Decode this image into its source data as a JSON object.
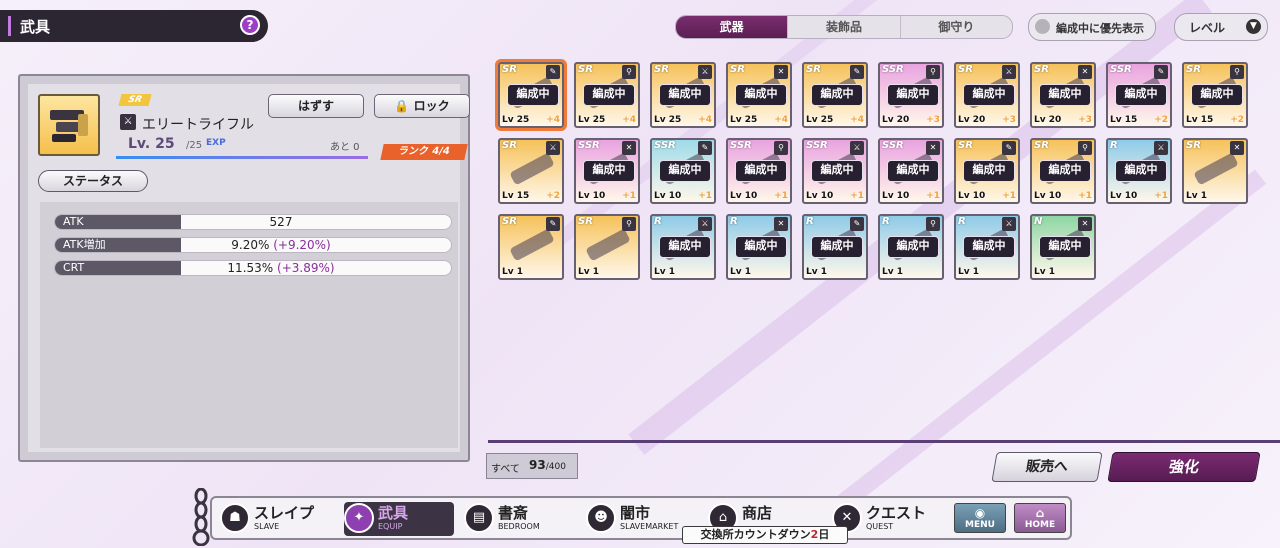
{
  "header": {
    "title": "武具",
    "help_label": "?"
  },
  "tabs": [
    {
      "label": "武器",
      "active": true
    },
    {
      "label": "装飾品"
    },
    {
      "label": "御守り"
    }
  ],
  "priority_toggle": {
    "label": "編成中に優先表示"
  },
  "sort": {
    "label": "レベル",
    "caret": "▼"
  },
  "detail": {
    "rarity": "SR",
    "weapon_name": "エリートライフル",
    "unequip_label": "はずす",
    "lock_label": "ロック",
    "level": "Lv. 25",
    "level_max": "/25",
    "exp_label": "EXP",
    "remaining": "あと 0",
    "rank": "ランク 4/4",
    "status_label": "ステータス",
    "stats": [
      {
        "label": "ATK",
        "value": "527",
        "bonus": ""
      },
      {
        "label": "ATK増加",
        "value": "9.20%",
        "bonus": "(+9.20%)"
      },
      {
        "label": "CRT",
        "value": "11.53%",
        "bonus": "(+3.89%)"
      }
    ]
  },
  "equipped_label": "編成中",
  "items": [
    {
      "rarity": "SR",
      "level": "Lv 25",
      "plus": "+4",
      "equipped": true,
      "color": "#f6c25a",
      "selected": true
    },
    {
      "rarity": "SR",
      "level": "Lv 25",
      "plus": "+4",
      "equipped": true,
      "color": "#f6c25a"
    },
    {
      "rarity": "SR",
      "level": "Lv 25",
      "plus": "+4",
      "equipped": true,
      "color": "#f6c25a"
    },
    {
      "rarity": "SR",
      "level": "Lv 25",
      "plus": "+4",
      "equipped": true,
      "color": "#f6c25a"
    },
    {
      "rarity": "SR",
      "level": "Lv 25",
      "plus": "+4",
      "equipped": true,
      "color": "#f6c25a"
    },
    {
      "rarity": "SSR",
      "level": "Lv 20",
      "plus": "+3",
      "equipped": true,
      "color": "#e9a3e0"
    },
    {
      "rarity": "SR",
      "level": "Lv 20",
      "plus": "+3",
      "equipped": true,
      "color": "#f6c25a"
    },
    {
      "rarity": "SR",
      "level": "Lv 20",
      "plus": "+3",
      "equipped": true,
      "color": "#f6c25a"
    },
    {
      "rarity": "SSR",
      "level": "Lv 15",
      "plus": "+2",
      "equipped": true,
      "color": "#e9a3e0"
    },
    {
      "rarity": "SR",
      "level": "Lv 15",
      "plus": "+2",
      "equipped": true,
      "color": "#f6c25a"
    },
    {
      "rarity": "SR",
      "level": "Lv 15",
      "plus": "+2",
      "equipped": false,
      "color": "#f6c25a"
    },
    {
      "rarity": "SSR",
      "level": "Lv 10",
      "plus": "+1",
      "equipped": true,
      "color": "#e9a3e0"
    },
    {
      "rarity": "SSR",
      "level": "Lv 10",
      "plus": "+1",
      "equipped": true,
      "color": "#9fdbe9"
    },
    {
      "rarity": "SSR",
      "level": "Lv 10",
      "plus": "+1",
      "equipped": true,
      "color": "#e9a3e0"
    },
    {
      "rarity": "SSR",
      "level": "Lv 10",
      "plus": "+1",
      "equipped": true,
      "color": "#e9a3e0"
    },
    {
      "rarity": "SSR",
      "level": "Lv 10",
      "plus": "+1",
      "equipped": true,
      "color": "#e9a3e0"
    },
    {
      "rarity": "SR",
      "level": "Lv 10",
      "plus": "+1",
      "equipped": true,
      "color": "#f6c25a"
    },
    {
      "rarity": "SR",
      "level": "Lv 10",
      "plus": "+1",
      "equipped": true,
      "color": "#f6c25a"
    },
    {
      "rarity": "R",
      "level": "Lv 10",
      "plus": "+1",
      "equipped": true,
      "color": "#8fcbe8"
    },
    {
      "rarity": "SR",
      "level": "Lv 1",
      "plus": "",
      "equipped": false,
      "color": "#f6c25a"
    },
    {
      "rarity": "SR",
      "level": "Lv 1",
      "plus": "",
      "equipped": false,
      "color": "#f6c25a"
    },
    {
      "rarity": "SR",
      "level": "Lv 1",
      "plus": "",
      "equipped": false,
      "color": "#f6c25a"
    },
    {
      "rarity": "R",
      "level": "Lv 1",
      "plus": "",
      "equipped": true,
      "color": "#8fcbe8"
    },
    {
      "rarity": "R",
      "level": "Lv 1",
      "plus": "",
      "equipped": true,
      "color": "#8fcbe8"
    },
    {
      "rarity": "R",
      "level": "Lv 1",
      "plus": "",
      "equipped": true,
      "color": "#8fcbe8"
    },
    {
      "rarity": "R",
      "level": "Lv 1",
      "plus": "",
      "equipped": true,
      "color": "#8fcbe8"
    },
    {
      "rarity": "R",
      "level": "Lv 1",
      "plus": "",
      "equipped": true,
      "color": "#8fcbe8"
    },
    {
      "rarity": "N",
      "level": "Lv 1",
      "plus": "",
      "equipped": true,
      "color": "#8fd6a4"
    }
  ],
  "footer": {
    "count_label": "すべて",
    "count": "93",
    "count_max": "/400",
    "sell_label": "販売へ",
    "enhance_label": "強化"
  },
  "nav": [
    {
      "jp": "スレイプ",
      "en": "SLAVE"
    },
    {
      "jp": "武具",
      "en": "EQUIP",
      "active": true
    },
    {
      "jp": "書斎",
      "en": "BEDROOM"
    },
    {
      "jp": "闇市",
      "en": "SLAVEMARKET"
    },
    {
      "jp": "商店",
      "en": ""
    },
    {
      "jp": "クエスト",
      "en": "QUEST"
    }
  ],
  "menu_label": "MENU",
  "home_label": "HOME",
  "countdown": {
    "label": "交換所カウントダウン",
    "days": "2",
    "unit": "日"
  }
}
